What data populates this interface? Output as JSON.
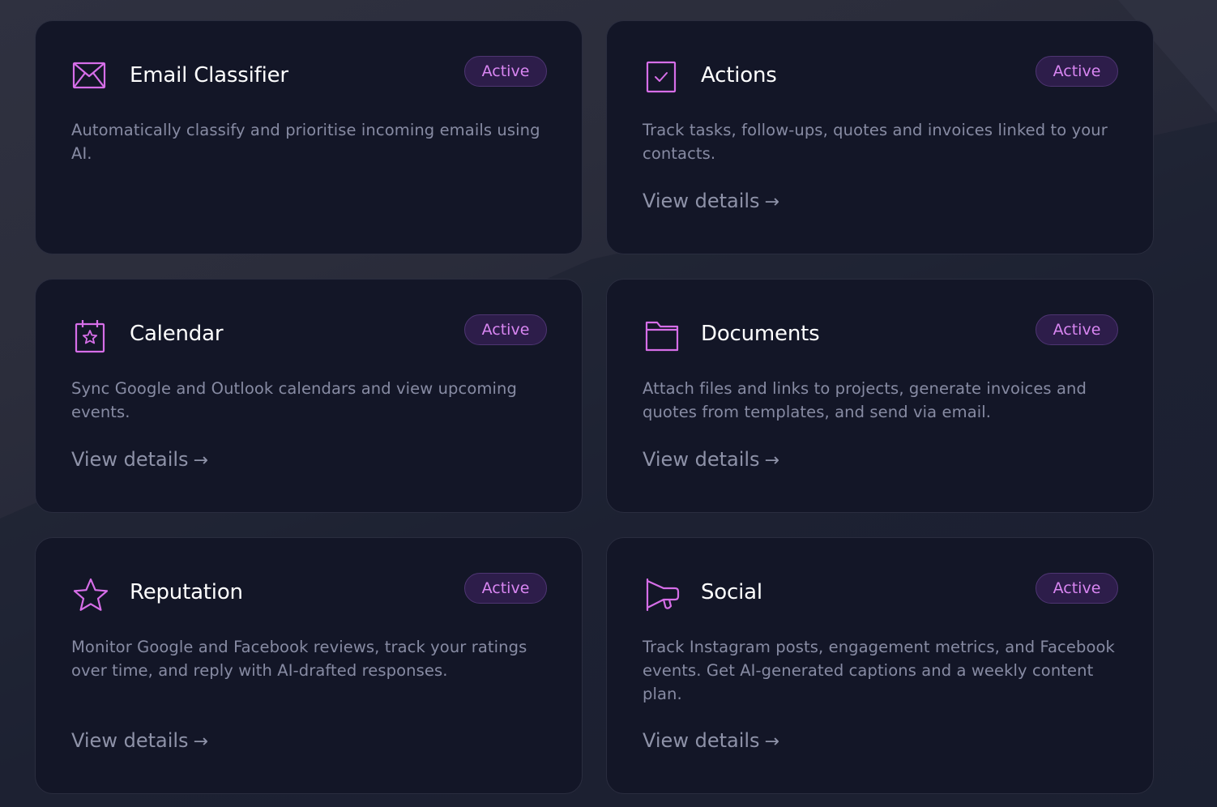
{
  "cards": [
    {
      "title": "Email Classifier",
      "status": "Active",
      "description": "Automatically classify and prioritise incoming emails using AI.",
      "icon": "envelope-icon"
    },
    {
      "title": "Actions",
      "status": "Active",
      "description": "Track tasks, follow-ups, quotes and invoices linked to your contacts.",
      "link": "View details",
      "icon": "checkbox-icon"
    },
    {
      "title": "Calendar",
      "status": "Active",
      "description": "Sync Google and Outlook calendars and view upcoming events.",
      "link": "View details",
      "icon": "calendar-star-icon"
    },
    {
      "title": "Documents",
      "status": "Active",
      "description": "Attach files and links to projects, generate invoices and quotes from templates, and send via email.",
      "link": "View details",
      "icon": "folder-icon"
    },
    {
      "title": "Reputation",
      "status": "Active",
      "description": "Monitor Google and Facebook reviews, track your ratings over time, and reply with AI-drafted responses.",
      "link": "View details",
      "icon": "star-icon"
    },
    {
      "title": "Social",
      "status": "Active",
      "description": "Track Instagram posts, engagement metrics, and Facebook events. Get AI-generated captions and a weekly content plan.",
      "link": "View details",
      "icon": "megaphone-icon"
    }
  ],
  "arrow_glyph": "→",
  "colors": {
    "accent": "#d66ee8",
    "badge_text": "#d986f2",
    "badge_bg": "#2d1d4a",
    "card_bg": "#131627",
    "title": "#ffffff",
    "muted_text": "#878ba3"
  }
}
